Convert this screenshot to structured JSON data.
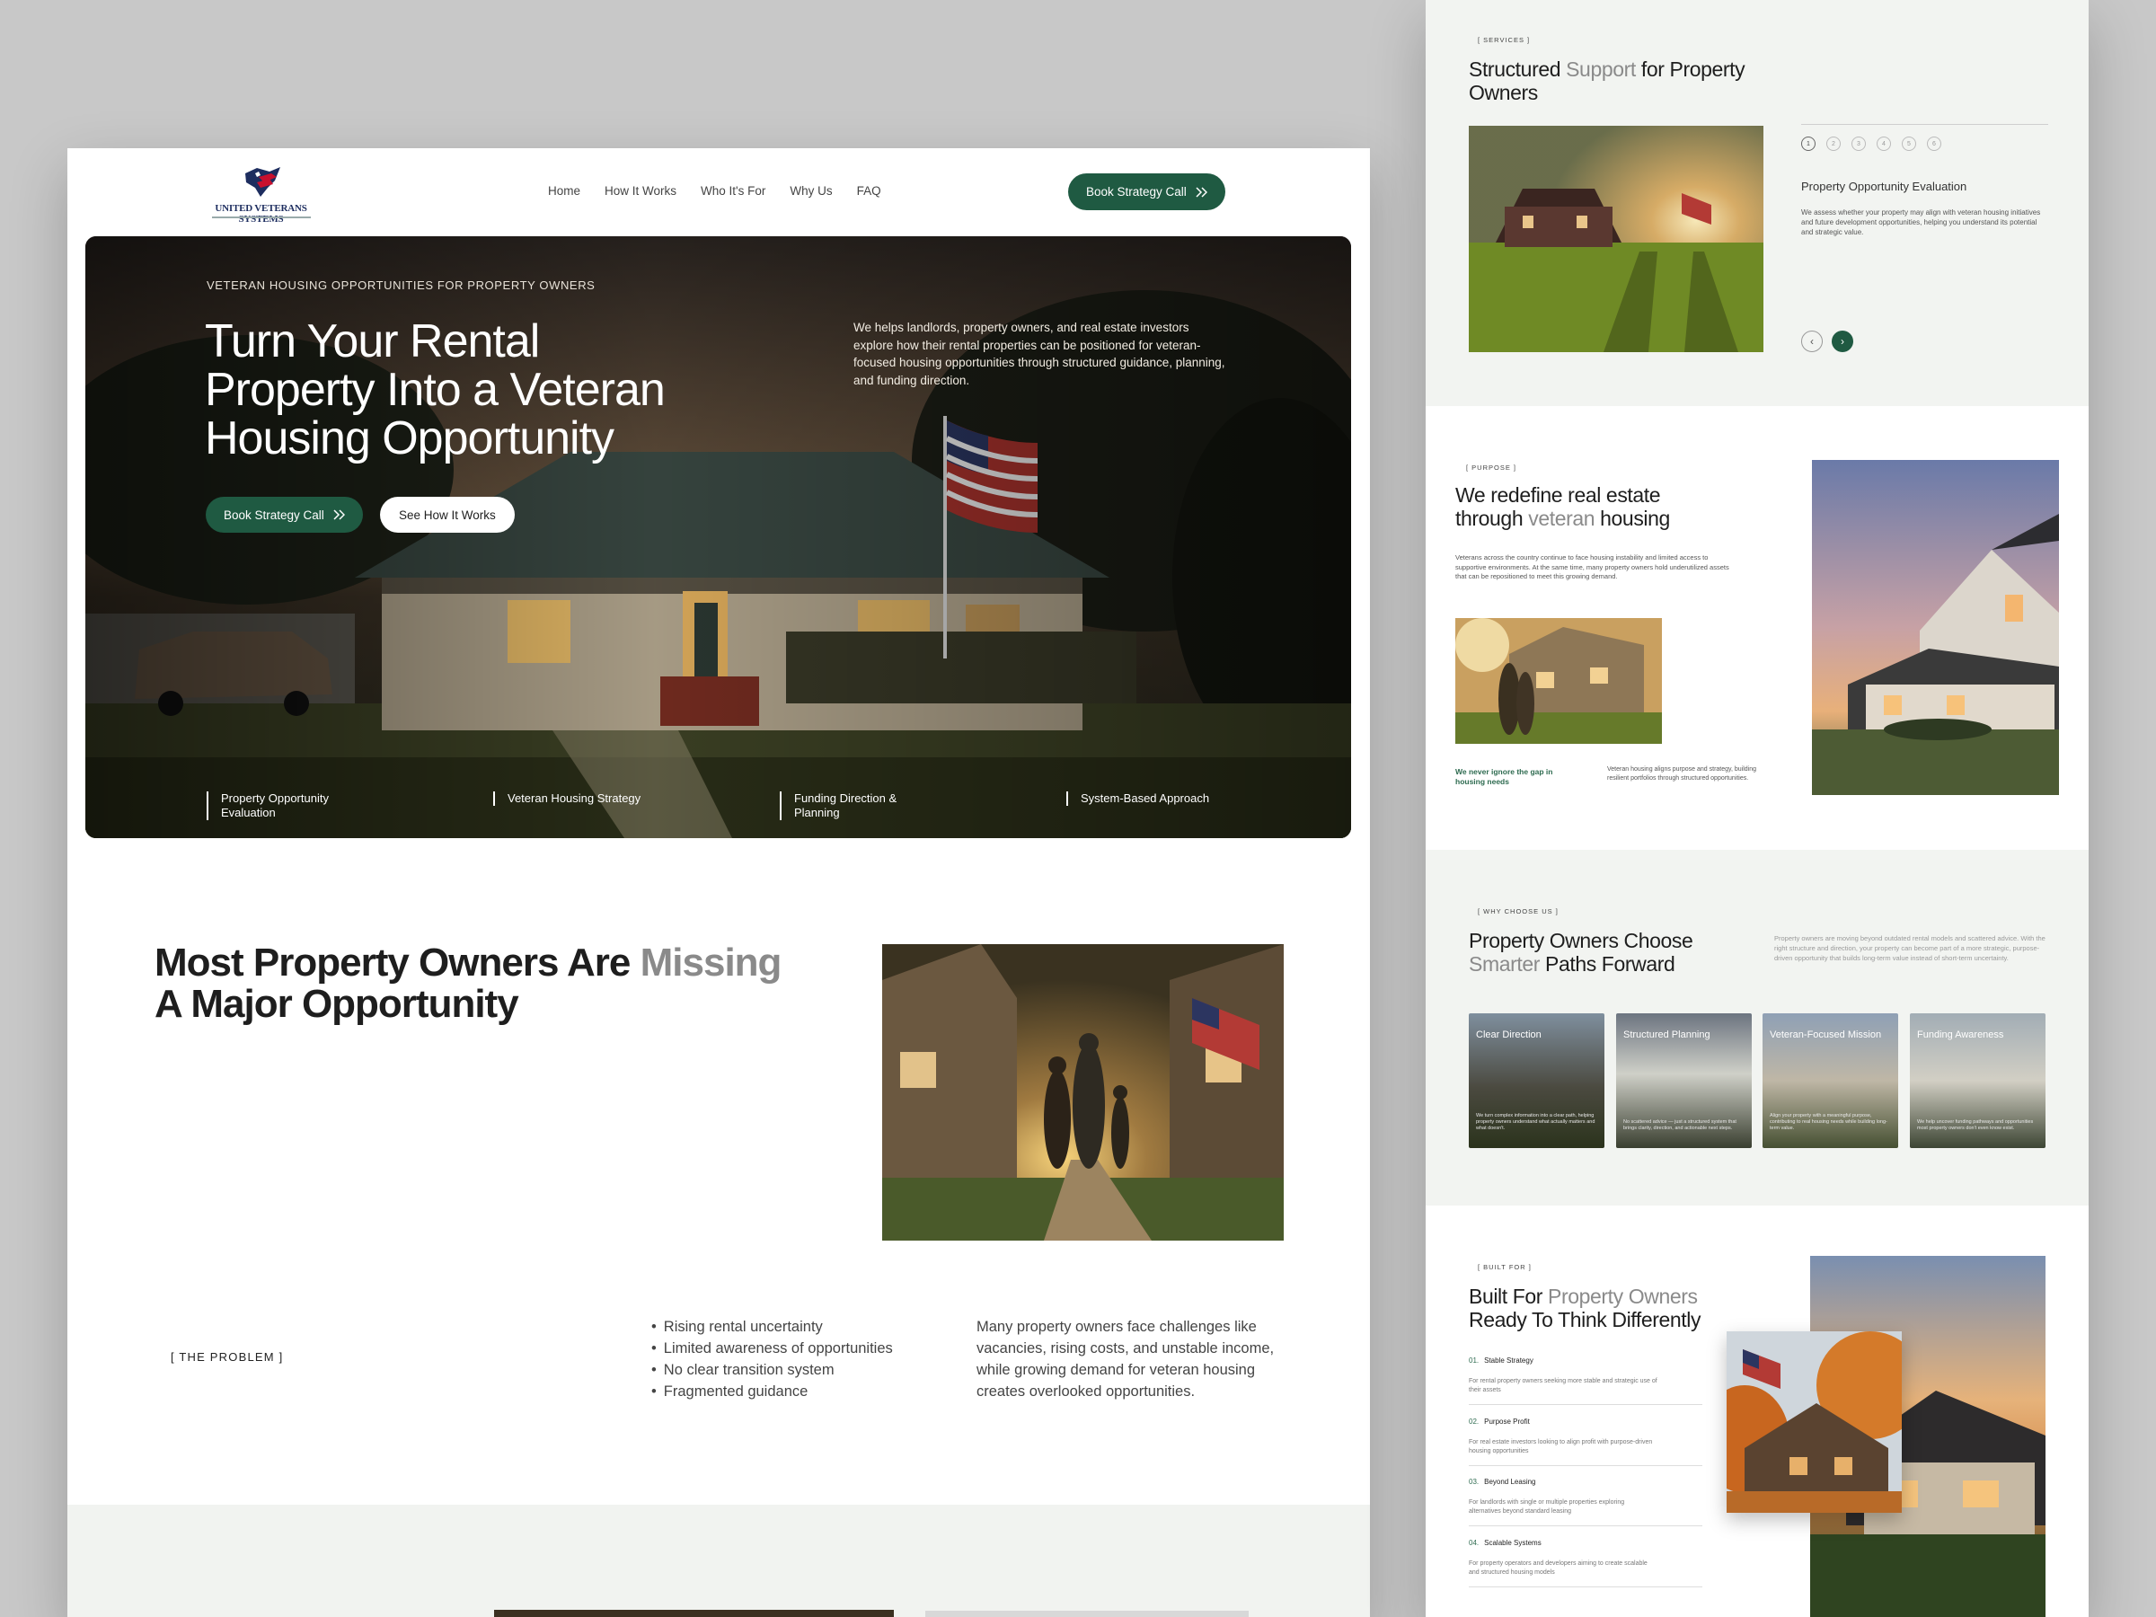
{
  "left": {
    "logo": {
      "text": "UNITED VETERANS SYSTEMS"
    },
    "nav": {
      "items": [
        "Home",
        "How It Works",
        "Who It's For",
        "Why Us",
        "FAQ"
      ],
      "cta": "Book Strategy Call"
    },
    "hero": {
      "eyebrow": "VETERAN HOUSING OPPORTUNITIES FOR PROPERTY OWNERS",
      "title": "Turn Your Rental Property Into a Veteran Housing Opportunity",
      "description": "We helps landlords, property owners, and real estate investors explore how their rental properties can be positioned for veteran-focused housing opportunities through structured guidance, planning, and funding direction.",
      "primary_button": "Book Strategy Call",
      "secondary_button": "See How It Works",
      "features": [
        "Property Opportunity Evaluation",
        "Veteran Housing Strategy",
        "Funding Direction & Planning",
        "System-Based Approach"
      ]
    },
    "problem": {
      "title_main": "Most Property Owners Are",
      "title_highlight": "Missing",
      "title_end": "A Major Opportunity",
      "tag": "[ THE PROBLEM ]",
      "bullets": [
        "Rising rental uncertainty",
        "Limited awareness of opportunities",
        "No clear transition system",
        "Fragmented guidance"
      ],
      "text": "Many property owners face challenges like vacancies, rising costs, and unstable income, while growing demand for veteran housing creates overlooked opportunities."
    }
  },
  "right": {
    "services": {
      "tag": "[ SERVICES ]",
      "title_a": "Structured",
      "title_hl": "Support",
      "title_b": "for Property Owners",
      "steps": [
        "1",
        "2",
        "3",
        "4",
        "5",
        "6"
      ],
      "item_title": "Property Opportunity Evaluation",
      "item_text": "We assess whether your property may align with veteran housing initiatives and future development opportunities, helping you understand its potential and strategic value."
    },
    "purpose": {
      "tag": "[ PURPOSE ]",
      "title_a": "We redefine real estate through",
      "title_hl": "veteran",
      "title_b": "housing",
      "text": "Veterans across the country continue to face housing instability and limited access to supportive environments. At the same time, many property owners hold underutilized assets that can be repositioned to meet this growing demand.",
      "callout": "We never ignore the gap in housing needs",
      "callout_text": "Veteran housing aligns purpose and strategy, building resilient portfolios through structured opportunities."
    },
    "why": {
      "tag": "[ WHY CHOOSE US ]",
      "title_a": "Property Owners Choose",
      "title_hl": "Smarter",
      "title_b": "Paths Forward",
      "text": "Property owners are moving beyond outdated rental models and scattered advice. With the right structure and direction, your property can become part of a more strategic, purpose-driven opportunity that builds long-term value instead of short-term uncertainty.",
      "cards": [
        {
          "label": "Clear Direction",
          "text": "We turn complex information into a clear path, helping property owners understand what actually matters and what doesn't."
        },
        {
          "label": "Structured Planning",
          "text": "No scattered advice — just a structured system that brings clarity, direction, and actionable next steps."
        },
        {
          "label": "Veteran-Focused Mission",
          "text": "Align your property with a meaningful purpose, contributing to real housing needs while building long-term value."
        },
        {
          "label": "Funding Awareness",
          "text": "We help uncover funding pathways and opportunities most property owners don't even know exist."
        }
      ]
    },
    "built": {
      "tag": "[ BUILT FOR ]",
      "title_a": "Built For",
      "title_hl": "Property Owners",
      "title_b": "Ready To Think Differently",
      "items": [
        {
          "num": "01.",
          "title": "Stable Strategy",
          "text": "For rental property owners seeking more stable and strategic use of their assets"
        },
        {
          "num": "02.",
          "title": "Purpose Profit",
          "text": "For real estate investors looking to align profit with purpose-driven housing opportunities"
        },
        {
          "num": "03.",
          "title": "Beyond Leasing",
          "text": "For landlords with single or multiple properties exploring alternatives beyond standard leasing"
        },
        {
          "num": "04.",
          "title": "Scalable Systems",
          "text": "For property operators and developers aiming to create scalable and structured housing models"
        }
      ]
    }
  },
  "colors": {
    "brand_green": "#1f5a42",
    "muted_text": "#8a8a8a",
    "section_grey": "#f1f3f0"
  },
  "icons": [
    "flag-logo-icon",
    "double-chevron-right-icon",
    "arrow-left-icon",
    "arrow-right-icon"
  ]
}
